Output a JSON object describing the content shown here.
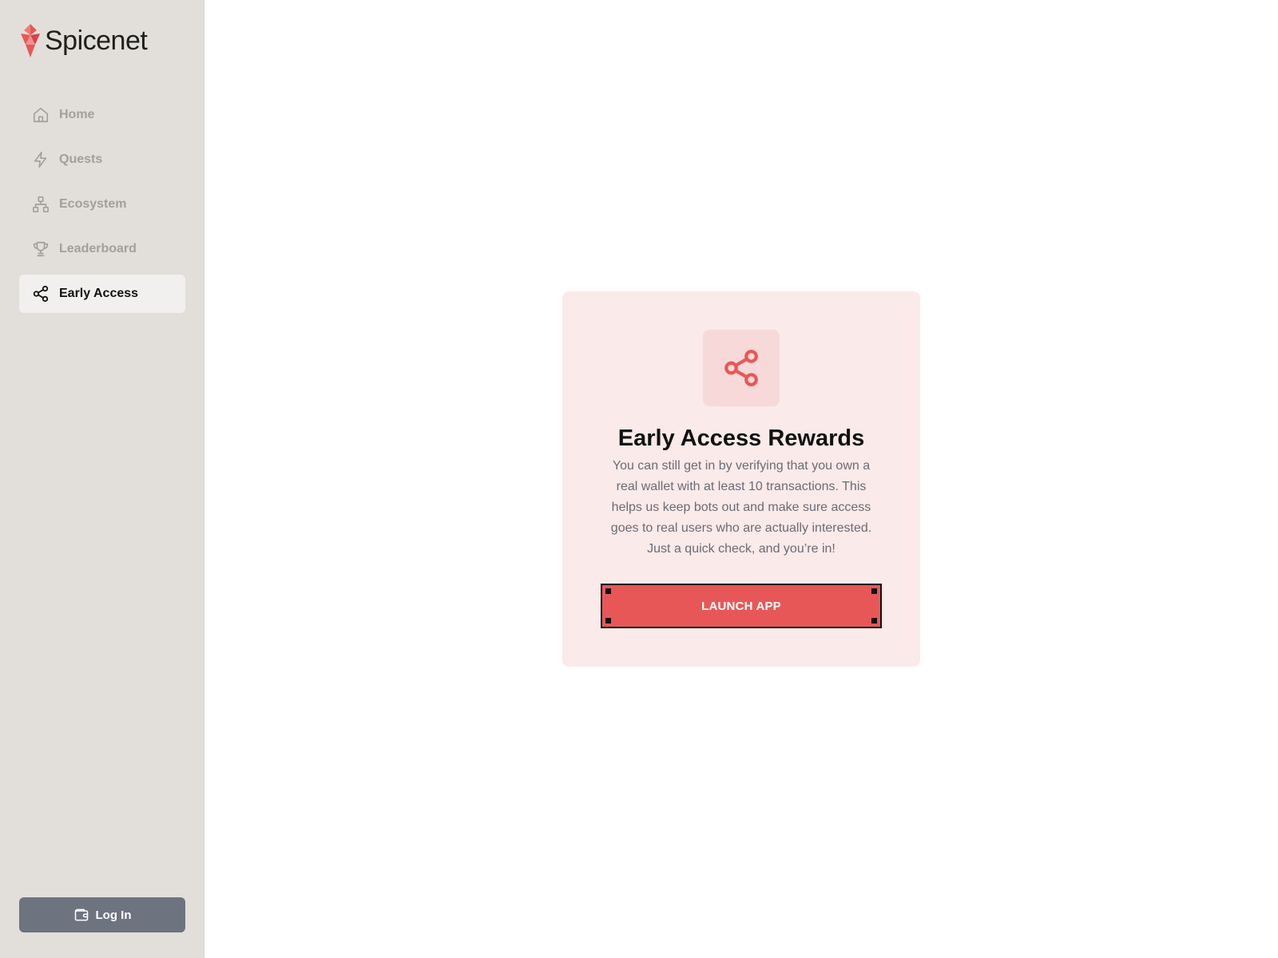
{
  "brand": {
    "name": "Spicenet",
    "accent": "#e85757"
  },
  "sidebar": {
    "items": [
      {
        "label": "Home",
        "icon": "home-icon",
        "active": false
      },
      {
        "label": "Quests",
        "icon": "lightning-icon",
        "active": false
      },
      {
        "label": "Ecosystem",
        "icon": "network-icon",
        "active": false
      },
      {
        "label": "Leaderboard",
        "icon": "trophy-icon",
        "active": false
      },
      {
        "label": "Early Access",
        "icon": "share-icon",
        "active": true
      }
    ],
    "login_label": "Log In"
  },
  "card": {
    "icon": "share-icon",
    "title": "Early Access Rewards",
    "description": "You can still get in by verifying that you own a real wallet with at least 10 transactions. This helps us keep bots out and make sure access goes to real users who are actually interested. Just a quick check, and you’re in!",
    "button_label": "LAUNCH APP"
  },
  "colors": {
    "sidebar_bg": "#e2dfda",
    "card_bg": "#fbeaea",
    "button_bg": "#e85757",
    "login_bg": "#6e7380"
  }
}
